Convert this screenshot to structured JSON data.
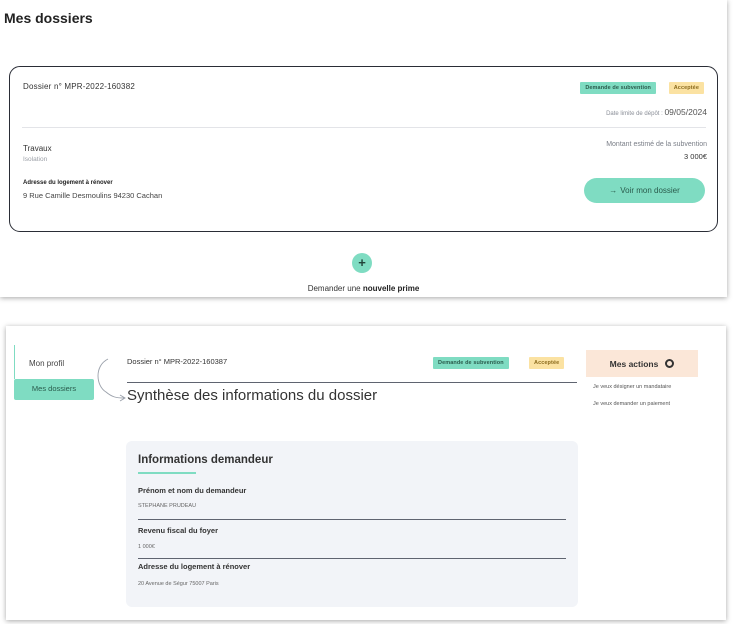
{
  "top": {
    "title": "Mes dossiers",
    "dossier": {
      "number": "Dossier n° MPR-2022-160382",
      "badges": [
        "Demande de subvention",
        "Acceptée"
      ],
      "date_label": "Date limite de dépôt :",
      "date_value": "09/05/2024",
      "travaux_label": "Travaux",
      "travaux_value": "Isolation",
      "montant_label": "Montant estimé de la subvention",
      "montant_value": "3 000€",
      "address_label": "Adresse du logement à rénover",
      "address_value": "9 Rue Camille Desmoulins 94230 Cachan",
      "voir_button": "Voir mon dossier"
    },
    "add_prefix": "Demander une",
    "add_bold": "nouvelle prime"
  },
  "bottom": {
    "sidebar": [
      "Mon profil",
      "Mes dossiers"
    ],
    "dossier_number": "Dossier n° MPR-2022-160387",
    "badges": [
      "Demande de subvention",
      "Acceptée"
    ],
    "page_title": "Synthèse des informations du dossier",
    "info": {
      "title": "Informations demandeur",
      "fields": [
        {
          "label": "Prénom et nom du demandeur",
          "value": "STEPHANE PRUDEAU"
        },
        {
          "label": "Revenu fiscal du foyer",
          "value": "1 000€"
        },
        {
          "label": "Adresse du logement à rénover",
          "value": "20 Avenue de Ségur 75007 Paris"
        }
      ]
    },
    "actions_title": "Mes actions",
    "actions": [
      "Je veux désigner un mandataire",
      "Je veux demander un paiement"
    ]
  },
  "colors": {
    "accent_green": "#7fdcc2",
    "badge_yellow": "#fbe2a2",
    "actions_bg": "#fbe7d8"
  }
}
